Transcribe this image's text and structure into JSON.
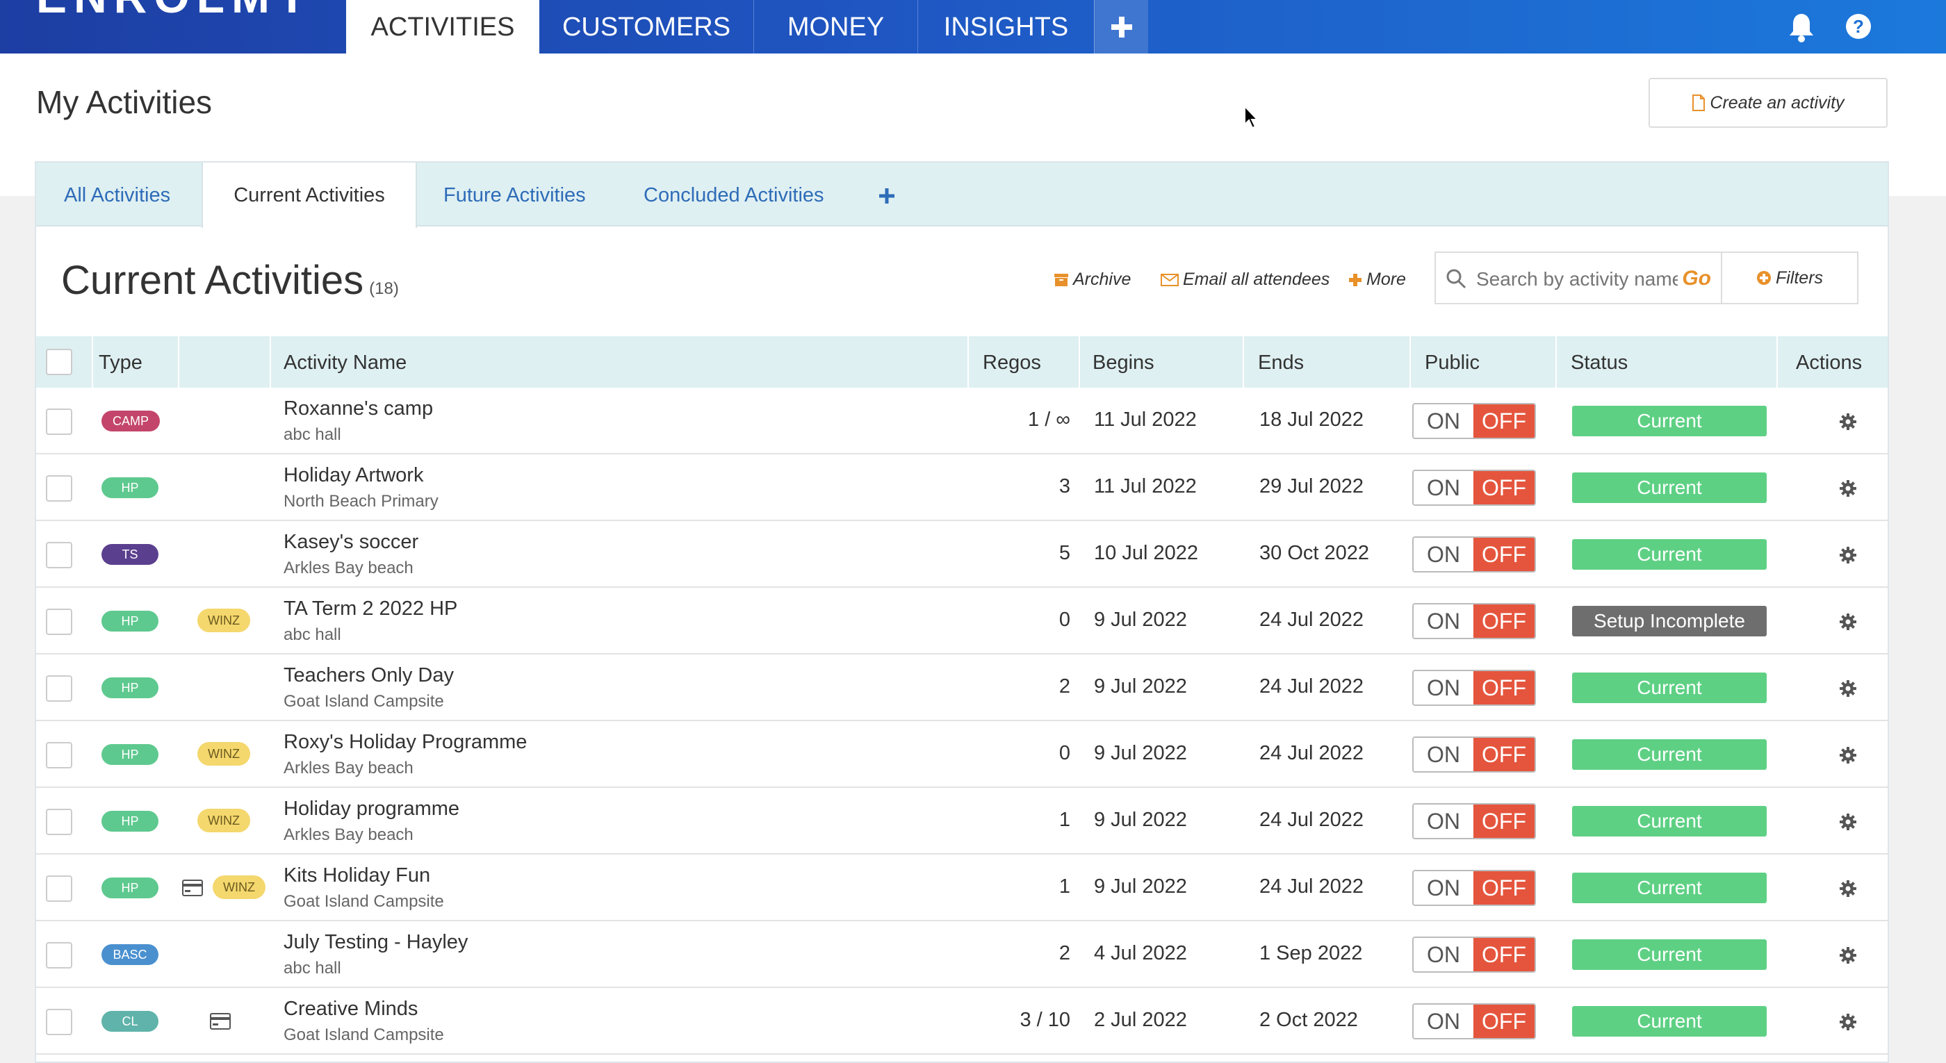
{
  "nav": {
    "logo": "ENROLMY",
    "tabs": [
      {
        "label": "ACTIVITIES",
        "active": true
      },
      {
        "label": "CUSTOMERS",
        "active": false
      },
      {
        "label": "MONEY",
        "active": false
      },
      {
        "label": "INSIGHTS",
        "active": false
      }
    ],
    "add_icon": "plus-icon",
    "notifications_icon": "bell-icon",
    "help_icon": "question-circle-icon"
  },
  "page": {
    "title": "My Activities",
    "create_button": "Create an activity"
  },
  "subtabs": [
    {
      "label": "All Activities",
      "active": false
    },
    {
      "label": "Current Activities",
      "active": true
    },
    {
      "label": "Future Activities",
      "active": false
    },
    {
      "label": "Concluded Activities",
      "active": false
    }
  ],
  "list": {
    "title": "Current Activities",
    "count": "(18)",
    "archive": "Archive",
    "email": "Email all attendees",
    "more": "More",
    "search_placeholder": "Search by activity name",
    "go": "Go",
    "filters": "Filters"
  },
  "table": {
    "headers": {
      "type": "Type",
      "name": "Activity Name",
      "regos": "Regos",
      "begins": "Begins",
      "ends": "Ends",
      "public": "Public",
      "status": "Status",
      "actions": "Actions"
    },
    "toggle_on": "ON",
    "toggle_off": "OFF",
    "rows": [
      {
        "type": "CAMP",
        "winz": "",
        "card": false,
        "name": "Roxanne's camp",
        "location": "abc hall",
        "regos": "1 / ∞",
        "begins": "11 Jul 2022",
        "ends": "18 Jul 2022",
        "status": "Current"
      },
      {
        "type": "HP",
        "winz": "",
        "card": false,
        "name": "Holiday Artwork",
        "location": "North Beach Primary",
        "regos": "3",
        "begins": "11 Jul 2022",
        "ends": "29 Jul 2022",
        "status": "Current"
      },
      {
        "type": "TS",
        "winz": "",
        "card": false,
        "name": "Kasey's soccer",
        "location": "Arkles Bay beach",
        "regos": "5",
        "begins": "10 Jul 2022",
        "ends": "30 Oct 2022",
        "status": "Current"
      },
      {
        "type": "HP",
        "winz": "WINZ",
        "card": false,
        "name": "TA Term 2 2022 HP",
        "location": "abc hall",
        "regos": "0",
        "begins": "9 Jul 2022",
        "ends": "24 Jul 2022",
        "status": "Setup Incomplete"
      },
      {
        "type": "HP",
        "winz": "",
        "card": false,
        "name": "Teachers Only Day",
        "location": "Goat Island Campsite",
        "regos": "2",
        "begins": "9 Jul 2022",
        "ends": "24 Jul 2022",
        "status": "Current"
      },
      {
        "type": "HP",
        "winz": "WINZ",
        "card": false,
        "name": "Roxy's Holiday Programme",
        "location": "Arkles Bay beach",
        "regos": "0",
        "begins": "9 Jul 2022",
        "ends": "24 Jul 2022",
        "status": "Current"
      },
      {
        "type": "HP",
        "winz": "WINZ",
        "card": false,
        "name": "Holiday programme",
        "location": "Arkles Bay beach",
        "regos": "1",
        "begins": "9 Jul 2022",
        "ends": "24 Jul 2022",
        "status": "Current"
      },
      {
        "type": "HP",
        "winz": "WINZ",
        "card": true,
        "name": "Kits Holiday Fun",
        "location": "Goat Island Campsite",
        "regos": "1",
        "begins": "9 Jul 2022",
        "ends": "24 Jul 2022",
        "status": "Current"
      },
      {
        "type": "BASC",
        "winz": "",
        "card": false,
        "name": "July Testing - Hayley",
        "location": "abc hall",
        "regos": "2",
        "begins": "4 Jul 2022",
        "ends": "1 Sep 2022",
        "status": "Current"
      },
      {
        "type": "CL",
        "winz": "",
        "card": true,
        "name": "Creative Minds",
        "location": "Goat Island Campsite",
        "regos": "3 / 10",
        "begins": "2 Jul 2022",
        "ends": "2 Oct 2022",
        "status": "Current"
      }
    ]
  },
  "colors": {
    "CAMP": "#c4456b",
    "HP": "#5ec98f",
    "TS": "#5b3f8f",
    "BASC": "#4a90cf",
    "CL": "#5fb3aa",
    "status_current": "#5ed084",
    "status_incomplete": "#6e6e6e"
  }
}
